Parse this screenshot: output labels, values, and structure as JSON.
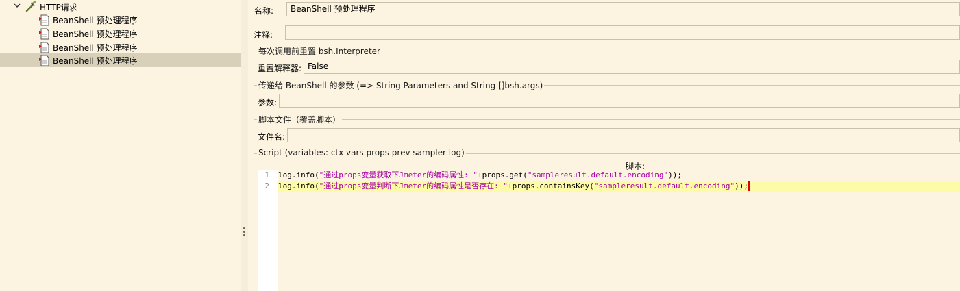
{
  "tree": {
    "parent": {
      "label": "HTTP请求",
      "icon": "dropper-icon",
      "expanded": true
    },
    "children": [
      {
        "label": "BeanShell 预处理程序",
        "icon": "script-doc-icon",
        "selected": false
      },
      {
        "label": "BeanShell 预处理程序",
        "icon": "script-doc-icon",
        "selected": false
      },
      {
        "label": "BeanShell 预处理程序",
        "icon": "script-doc-icon",
        "selected": false
      },
      {
        "label": "BeanShell 预处理程序",
        "icon": "script-doc-icon",
        "selected": true
      }
    ]
  },
  "form": {
    "name_label": "名称:",
    "name_value": "BeanShell 预处理程序",
    "comment_label": "注释:",
    "comment_value": "",
    "reset_group": {
      "title": "每次调用前重置 bsh.Interpreter",
      "label": "重置解释器:",
      "value": "False"
    },
    "params_group": {
      "title": "传递给 BeanShell 的参数 (=> String Parameters and String []bsh.args)",
      "label": "参数:",
      "value": ""
    },
    "file_group": {
      "title": "脚本文件（覆盖脚本）",
      "label": "文件名:",
      "value": ""
    },
    "script_group": {
      "title": "Script (variables: ctx vars props prev sampler log)",
      "heading": "脚本:"
    }
  },
  "editor": {
    "lines": [
      {
        "number": "1",
        "pre": "log.info(",
        "str1": "\"通过props变量获取下Jmeter的编码属性: \"",
        "mid": "+props.get(",
        "str2": "\"sampleresult.default.encoding\"",
        "post": "));"
      },
      {
        "number": "2",
        "pre": "log.info(",
        "str1": "\"通过props变量判断下Jmeter的编码属性是否存在: \"",
        "mid": "+props.containsKey(",
        "str2": "\"sampleresult.default.encoding\"",
        "post": "));"
      }
    ],
    "colors": {
      "string": "#a800a8",
      "current_line": "#fdfaa8",
      "caret": "#e00000"
    }
  }
}
